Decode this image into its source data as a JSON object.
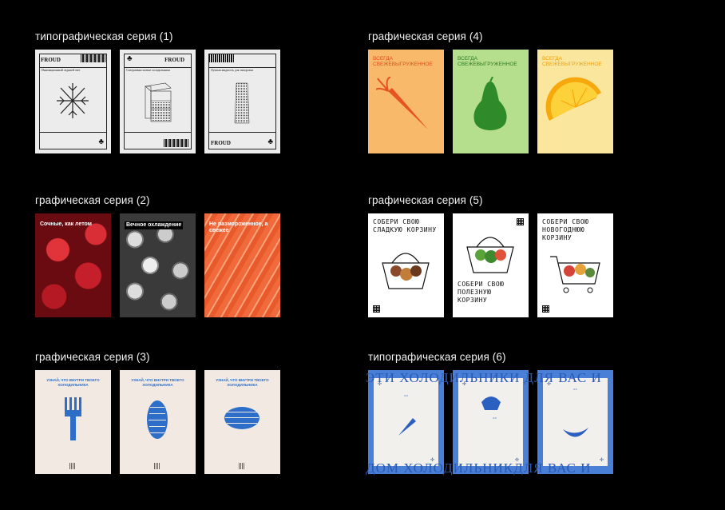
{
  "series": [
    {
      "title": "типографическая серия (1)"
    },
    {
      "title": "графическая серия (4)"
    },
    {
      "title": "графическая серия (2)"
    },
    {
      "title": "графическая серия (5)"
    },
    {
      "title": "графическая серия (3)"
    },
    {
      "title": "типографическая серия (6)"
    }
  ],
  "typo1": {
    "brand": "FROUD",
    "subs": [
      "Инновационный ледяной свет",
      "Совершенно новые холодильники",
      "Лучшая жидкость для заморозки"
    ]
  },
  "photo": {
    "captions": [
      "Сочные, как летом",
      "Вечное охлаждение",
      "Не размороженное, а свежее"
    ]
  },
  "fridge": {
    "title": "УЗНАЙ, ЧТО ВНУТРИ ТВОЕГО ХОЛОДИЛЬНИКА"
  },
  "fresh": {
    "headline": "ВСЕГДА СВЕЖЕВЫГРУЖЕННОЕ"
  },
  "basket": {
    "texts": [
      "СОБЕРИ СВОЮ СЛАДКУЮ КОРЗИНУ",
      "СОБЕРИ СВОЮ ПОЛЕЗНУЮ КОРЗИНУ",
      "СОБЕРИ СВОЮ НОВОГОДНЮЮ КОРЗИНУ"
    ]
  },
  "blue": {
    "banner_top": "ЭТИ ХОЛОДИЛЬНИКИ ДЛЯ ВАС И",
    "banner_bottom": "ДОМ ХОЛОДИЛЬНИКДЛЯ ВАС И"
  },
  "colors": {
    "background": "#000000",
    "carrot": "#f9b96a",
    "pear": "#b6df8d",
    "lemon": "#fbe69d",
    "fridge_blue": "#2d6ec8",
    "series6_blue": "#4a7fd8"
  }
}
